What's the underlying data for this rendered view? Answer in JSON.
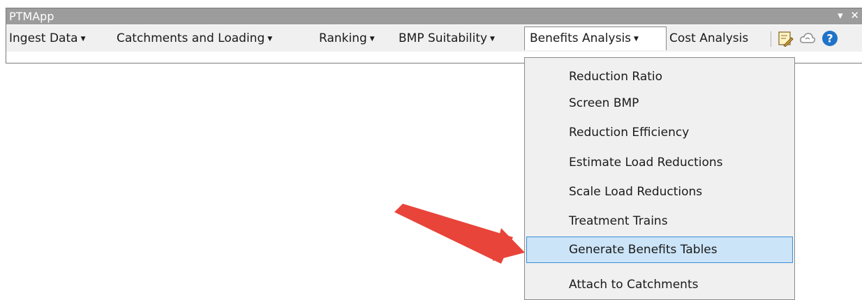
{
  "window": {
    "title": "PTMApp",
    "controls": {
      "dropdown_glyph": "▾",
      "close_glyph": "✕"
    }
  },
  "toolbar": {
    "menus": [
      {
        "label": "Ingest Data"
      },
      {
        "label": "Catchments and Loading"
      },
      {
        "label": "Ranking"
      },
      {
        "label": "BMP Suitability"
      },
      {
        "label": "Benefits Analysis",
        "state": "open"
      },
      {
        "label": "Cost Analysis"
      }
    ],
    "icons": [
      "edit-tool-icon",
      "cloud-icon",
      "help-icon"
    ]
  },
  "dropdown": {
    "items": [
      {
        "label": "Reduction Ratio"
      },
      {
        "label": "Screen BMP"
      },
      {
        "label": "Reduction Efficiency"
      },
      {
        "label": "Estimate Load Reductions"
      },
      {
        "label": "Scale Load Reductions"
      },
      {
        "label": "Treatment Trains"
      },
      {
        "label": "Generate Benefits Tables",
        "state": "hovered"
      },
      {
        "label": "Attach to Catchments"
      }
    ]
  },
  "colors": {
    "titlebar": "#9c9c9c",
    "toolbar": "#f0f0f0",
    "highlight": "#cce4f7",
    "highlight_border": "#3c8ed6",
    "annotation_arrow": "#e8443a",
    "help_icon": "#1e73c8"
  }
}
